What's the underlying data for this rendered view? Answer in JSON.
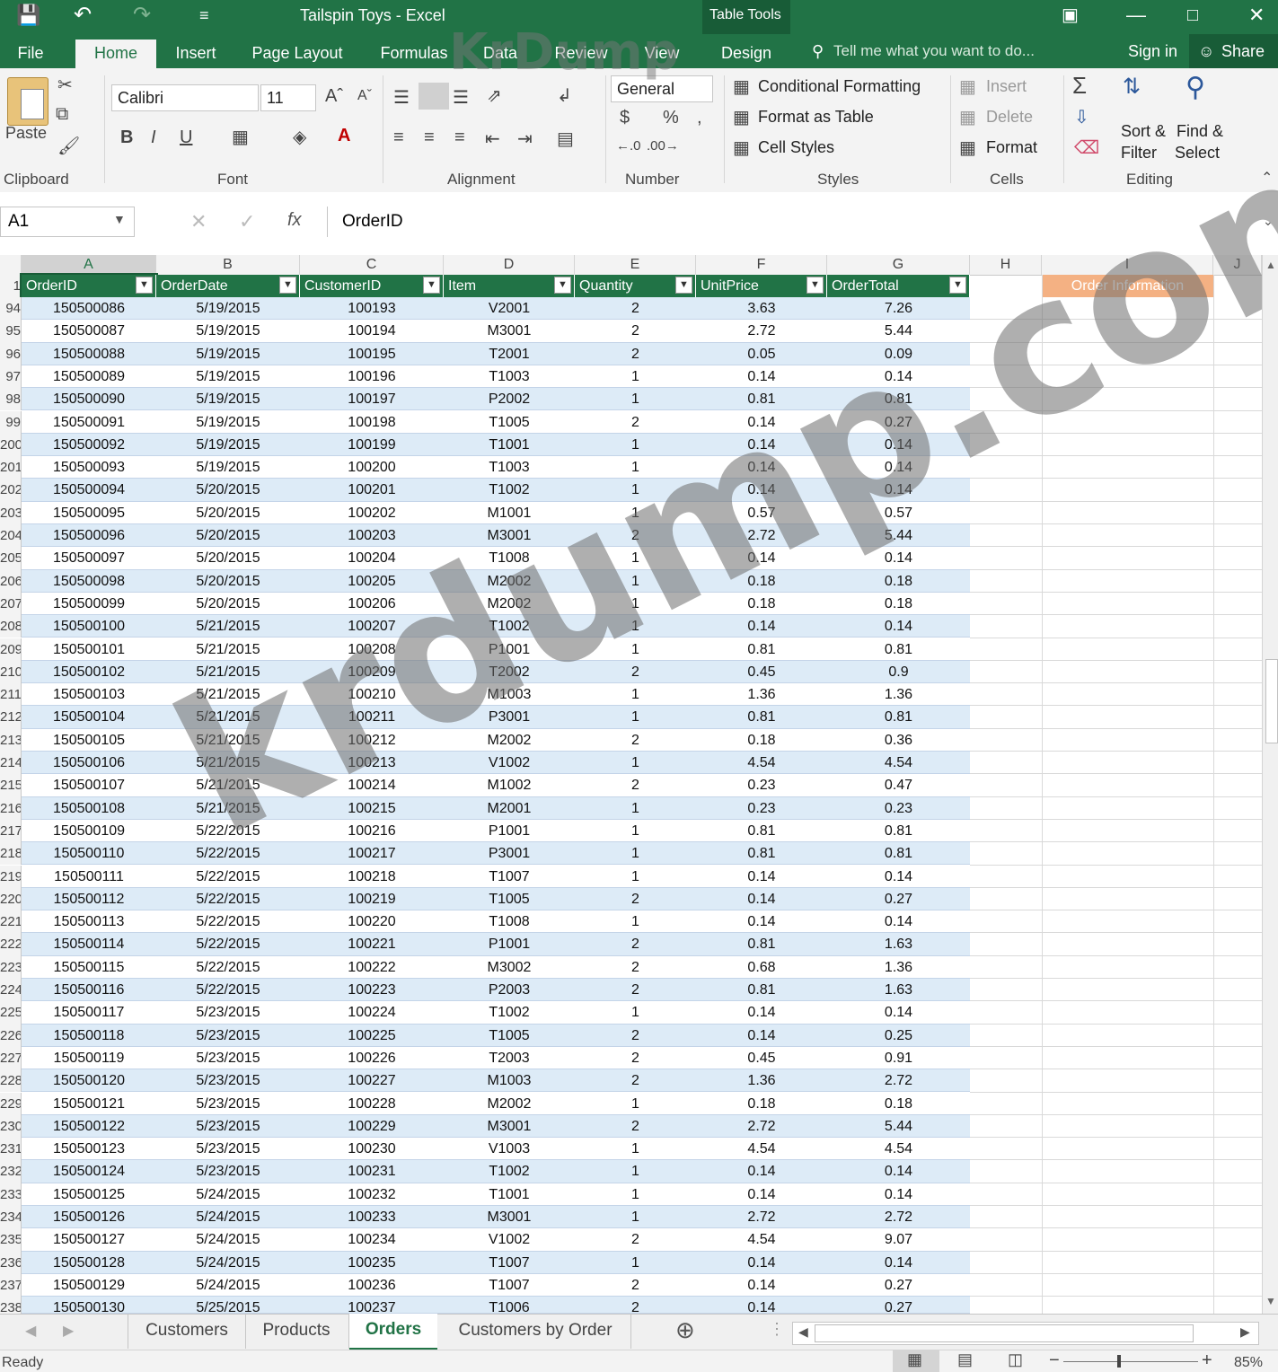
{
  "window": {
    "title": "Tailspin Toys - Excel",
    "context_label": "Table Tools",
    "sign_in": "Sign in",
    "share": "Share",
    "tell_me": "Tell me what you want to do..."
  },
  "tabs": [
    "File",
    "Home",
    "Insert",
    "Page Layout",
    "Formulas",
    "Data",
    "Review",
    "View",
    "Design"
  ],
  "ribbon": {
    "paste": "Paste",
    "font_name": "Calibri",
    "font_size": "11",
    "number_format": "General",
    "conditional_formatting": "Conditional Formatting",
    "format_as_table": "Format as Table",
    "cell_styles": "Cell Styles",
    "insert": "Insert",
    "delete": "Delete",
    "format": "Format",
    "sort_filter_1": "Sort &",
    "sort_filter_2": "Filter",
    "find_select_1": "Find &",
    "find_select_2": "Select",
    "groups": [
      "Clipboard",
      "Font",
      "Alignment",
      "Number",
      "Styles",
      "Cells",
      "Editing"
    ]
  },
  "formula_bar": {
    "name_box": "A1",
    "content": "OrderID"
  },
  "columns": [
    "A",
    "B",
    "C",
    "D",
    "E",
    "F",
    "G",
    "H",
    "I",
    "J"
  ],
  "headers": [
    "OrderID",
    "OrderDate",
    "CustomerID",
    "Item",
    "Quantity",
    "UnitPrice",
    "OrderTotal"
  ],
  "side_label": "Order Information",
  "rows": [
    [
      "94",
      "150500086",
      "5/19/2015",
      "100193",
      "V2001",
      "2",
      "3.63",
      "7.26"
    ],
    [
      "95",
      "150500087",
      "5/19/2015",
      "100194",
      "M3001",
      "2",
      "2.72",
      "5.44"
    ],
    [
      "96",
      "150500088",
      "5/19/2015",
      "100195",
      "T2001",
      "2",
      "0.05",
      "0.09"
    ],
    [
      "97",
      "150500089",
      "5/19/2015",
      "100196",
      "T1003",
      "1",
      "0.14",
      "0.14"
    ],
    [
      "98",
      "150500090",
      "5/19/2015",
      "100197",
      "P2002",
      "1",
      "0.81",
      "0.81"
    ],
    [
      "99",
      "150500091",
      "5/19/2015",
      "100198",
      "T1005",
      "2",
      "0.14",
      "0.27"
    ],
    [
      "200",
      "150500092",
      "5/19/2015",
      "100199",
      "T1001",
      "1",
      "0.14",
      "0.14"
    ],
    [
      "201",
      "150500093",
      "5/19/2015",
      "100200",
      "T1003",
      "1",
      "0.14",
      "0.14"
    ],
    [
      "202",
      "150500094",
      "5/20/2015",
      "100201",
      "T1002",
      "1",
      "0.14",
      "0.14"
    ],
    [
      "203",
      "150500095",
      "5/20/2015",
      "100202",
      "M1001",
      "1",
      "0.57",
      "0.57"
    ],
    [
      "204",
      "150500096",
      "5/20/2015",
      "100203",
      "M3001",
      "2",
      "2.72",
      "5.44"
    ],
    [
      "205",
      "150500097",
      "5/20/2015",
      "100204",
      "T1008",
      "1",
      "0.14",
      "0.14"
    ],
    [
      "206",
      "150500098",
      "5/20/2015",
      "100205",
      "M2002",
      "1",
      "0.18",
      "0.18"
    ],
    [
      "207",
      "150500099",
      "5/20/2015",
      "100206",
      "M2002",
      "1",
      "0.18",
      "0.18"
    ],
    [
      "208",
      "150500100",
      "5/21/2015",
      "100207",
      "T1002",
      "1",
      "0.14",
      "0.14"
    ],
    [
      "209",
      "150500101",
      "5/21/2015",
      "100208",
      "P1001",
      "1",
      "0.81",
      "0.81"
    ],
    [
      "210",
      "150500102",
      "5/21/2015",
      "100209",
      "T2002",
      "2",
      "0.45",
      "0.9"
    ],
    [
      "211",
      "150500103",
      "5/21/2015",
      "100210",
      "M1003",
      "1",
      "1.36",
      "1.36"
    ],
    [
      "212",
      "150500104",
      "5/21/2015",
      "100211",
      "P3001",
      "1",
      "0.81",
      "0.81"
    ],
    [
      "213",
      "150500105",
      "5/21/2015",
      "100212",
      "M2002",
      "2",
      "0.18",
      "0.36"
    ],
    [
      "214",
      "150500106",
      "5/21/2015",
      "100213",
      "V1002",
      "1",
      "4.54",
      "4.54"
    ],
    [
      "215",
      "150500107",
      "5/21/2015",
      "100214",
      "M1002",
      "2",
      "0.23",
      "0.47"
    ],
    [
      "216",
      "150500108",
      "5/21/2015",
      "100215",
      "M2001",
      "1",
      "0.23",
      "0.23"
    ],
    [
      "217",
      "150500109",
      "5/22/2015",
      "100216",
      "P1001",
      "1",
      "0.81",
      "0.81"
    ],
    [
      "218",
      "150500110",
      "5/22/2015",
      "100217",
      "P3001",
      "1",
      "0.81",
      "0.81"
    ],
    [
      "219",
      "150500111",
      "5/22/2015",
      "100218",
      "T1007",
      "1",
      "0.14",
      "0.14"
    ],
    [
      "220",
      "150500112",
      "5/22/2015",
      "100219",
      "T1005",
      "2",
      "0.14",
      "0.27"
    ],
    [
      "221",
      "150500113",
      "5/22/2015",
      "100220",
      "T1008",
      "1",
      "0.14",
      "0.14"
    ],
    [
      "222",
      "150500114",
      "5/22/2015",
      "100221",
      "P1001",
      "2",
      "0.81",
      "1.63"
    ],
    [
      "223",
      "150500115",
      "5/22/2015",
      "100222",
      "M3002",
      "2",
      "0.68",
      "1.36"
    ],
    [
      "224",
      "150500116",
      "5/22/2015",
      "100223",
      "P2003",
      "2",
      "0.81",
      "1.63"
    ],
    [
      "225",
      "150500117",
      "5/23/2015",
      "100224",
      "T1002",
      "1",
      "0.14",
      "0.14"
    ],
    [
      "226",
      "150500118",
      "5/23/2015",
      "100225",
      "T1005",
      "2",
      "0.14",
      "0.25"
    ],
    [
      "227",
      "150500119",
      "5/23/2015",
      "100226",
      "T2003",
      "2",
      "0.45",
      "0.91"
    ],
    [
      "228",
      "150500120",
      "5/23/2015",
      "100227",
      "M1003",
      "2",
      "1.36",
      "2.72"
    ],
    [
      "229",
      "150500121",
      "5/23/2015",
      "100228",
      "M2002",
      "1",
      "0.18",
      "0.18"
    ],
    [
      "230",
      "150500122",
      "5/23/2015",
      "100229",
      "M3001",
      "2",
      "2.72",
      "5.44"
    ],
    [
      "231",
      "150500123",
      "5/23/2015",
      "100230",
      "V1003",
      "1",
      "4.54",
      "4.54"
    ],
    [
      "232",
      "150500124",
      "5/23/2015",
      "100231",
      "T1002",
      "1",
      "0.14",
      "0.14"
    ],
    [
      "233",
      "150500125",
      "5/24/2015",
      "100232",
      "T1001",
      "1",
      "0.14",
      "0.14"
    ],
    [
      "234",
      "150500126",
      "5/24/2015",
      "100233",
      "M3001",
      "1",
      "2.72",
      "2.72"
    ],
    [
      "235",
      "150500127",
      "5/24/2015",
      "100234",
      "V1002",
      "2",
      "4.54",
      "9.07"
    ],
    [
      "236",
      "150500128",
      "5/24/2015",
      "100235",
      "T1007",
      "1",
      "0.14",
      "0.14"
    ],
    [
      "237",
      "150500129",
      "5/24/2015",
      "100236",
      "T1007",
      "2",
      "0.14",
      "0.27"
    ],
    [
      "238",
      "150500130",
      "5/25/2015",
      "100237",
      "T1006",
      "2",
      "0.14",
      "0.27"
    ]
  ],
  "sheets": [
    "Customers",
    "Products",
    "Orders",
    "Customers by Order"
  ],
  "active_sheet": "Orders",
  "status": {
    "ready": "Ready",
    "zoom": "85%"
  },
  "watermark": "krdump.com",
  "watermark_logo": "KrDump",
  "colors": {
    "excel_green": "#217346",
    "band_blue": "#ddebf7",
    "accent_orange": "#f4b183"
  }
}
